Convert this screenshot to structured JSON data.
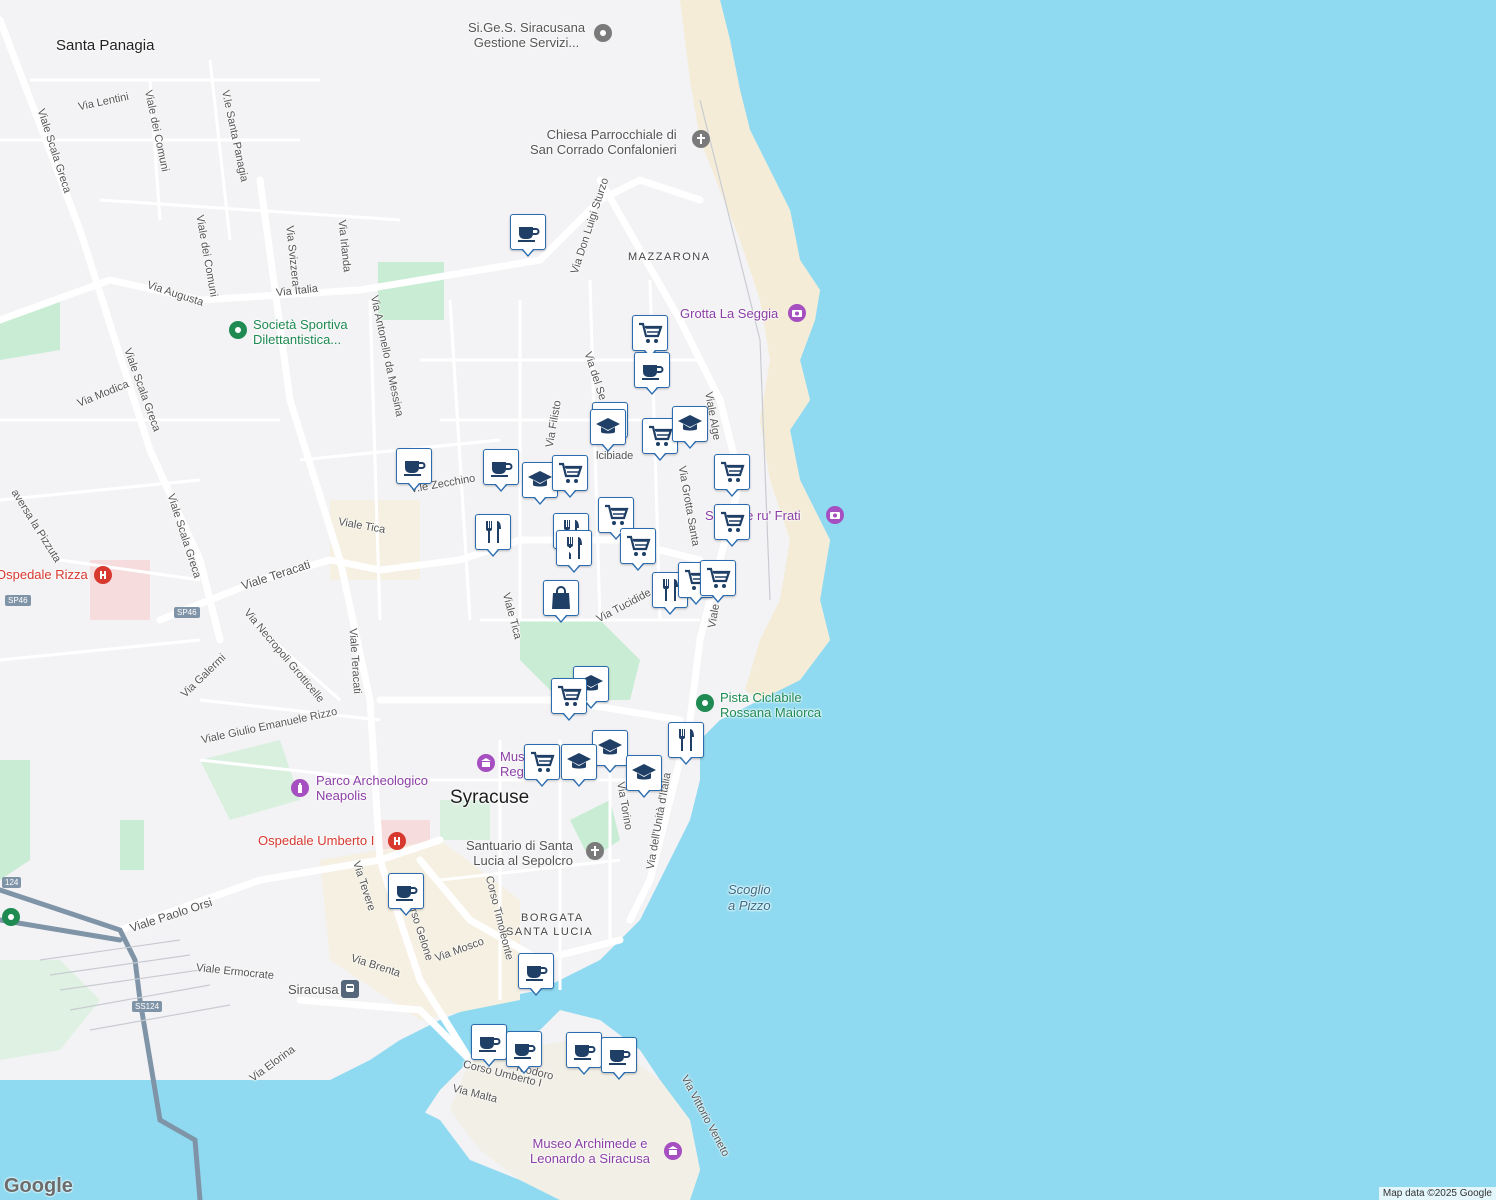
{
  "map": {
    "sea_color": "#8fdaf0",
    "land_color": "#f3f3f5",
    "park_color": "#c9ecd4",
    "beach_color": "#f4ecd7",
    "marker_color": "#2b6cb0"
  },
  "labels": {
    "areas": {
      "santa_panagia": "Santa Panagia",
      "mazzarona": "MAZZARONA",
      "syracuse": "Syracuse",
      "borgata": "BORGATA",
      "santa_lucia": "SANTA LUCIA"
    },
    "streets": {
      "via_lentini": "Via Lentini",
      "viale_scala_greca_1": "Viale Scala Greca",
      "viale_dei_comuni_1": "Viale dei Comuni",
      "viale_santa_panagia": "V.le Santa Panagia",
      "viale_dei_comuni_2": "Viale dei Comuni",
      "via_svizzera": "Via Svizzera",
      "via_irlanda": "Via Irlanda",
      "via_augusta": "Via Augusta",
      "via_italia": "Via Italia",
      "viale_scala_greca_2": "Viale Scala Greca",
      "via_antonello": "Via Antonello da Messina",
      "via_don_luigi_sturzo": "Via Don Luigi Sturzo",
      "via_modica": "Via Modica",
      "via_del_se": "Via del Se",
      "via_filisto": "Via Filisto",
      "alcibiade": "lcibiade",
      "viale_algeri": "Viale Alge",
      "viale_zecchino": "V.le Zecchino",
      "viale_scala_greca_3": "Viale Scala Greca",
      "traversa_pizzuta": "aversa la Pizzuta",
      "viale_tica_1": "Viale Tica",
      "viale_teracati_1": "Viale Teracati",
      "via_grotta_santa": "Via Grotta Santa",
      "via_tucidide": "Via Tucidide",
      "viale_tica_2": "Viale Tica",
      "via_necropoli": "Via Necropoli Grotticelle",
      "via_galermi": "Via Galermi",
      "viale_teracati_2": "Viale Teracati",
      "viale_giulio": "Viale Giulio Emanuele Rizzo",
      "via_torino": "Via Torino",
      "via_unita": "Via dell'Unità d'Italia",
      "viale_paolo_orsi": "Viale Paolo Orsi",
      "via_tevere": "Via Tevere",
      "corso_gelone": "Corso Gelone",
      "corso_timoleonte": "Corso Timoleonte",
      "via_mosco": "Via Mosco",
      "via_brenta": "Via Brenta",
      "viale_ermocrate": "Viale Ermocrate",
      "via_elorina": "Via Elorina",
      "corso_umberto": "Corso Umberto I",
      "via_teodoro": "Teodoro",
      "via_malta": "Via Malta",
      "via_vittorio_veneto": "Via Vittorio Veneto",
      "viale_lower": "Viale"
    },
    "roads": {
      "sp46_a": "SP46",
      "sp46_b": "SP46",
      "ss124": "SS124",
      "ss124_b": "124"
    },
    "pois": {
      "sigess": "Si.Ge.S. Siracusana\nGestione Servizi...",
      "chiesa": "Chiesa Parrocchiale di\nSan Corrado Confalonieri",
      "grotta": "Grotta La Seggia",
      "societa": "Società Sportiva\nDilettantistica...",
      "scoglio_frati": "S      o e ru' Frati",
      "ospedale_rizza": "Ospedale Rizza",
      "pista": "Pista Ciclabile\nRossana Maiorca",
      "museo_regionale": "Muse\nRegi",
      "parco": "Parco Archeologico\nNeapolis",
      "ospedale_umberto": "Ospedale Umberto I",
      "santuario": "Santuario di Santa\nLucia al Sepolcro",
      "scoglio_pizzo": "Scoglio\na Pizzo",
      "siracusa_station": "Siracusa",
      "museo_archimede": "Museo Archimede e\nLeonardo a Siracusa"
    }
  },
  "markers": [
    {
      "type": "cafe"
    },
    {
      "type": "cart"
    },
    {
      "type": "cafe"
    },
    {
      "type": "school"
    },
    {
      "type": "school"
    },
    {
      "type": "cart"
    },
    {
      "type": "school"
    },
    {
      "type": "cart"
    },
    {
      "type": "cafe"
    },
    {
      "type": "cafe"
    },
    {
      "type": "school"
    },
    {
      "type": "restaurant"
    },
    {
      "type": "cart"
    },
    {
      "type": "restaurant"
    },
    {
      "type": "cart"
    },
    {
      "type": "cart"
    },
    {
      "type": "cart"
    },
    {
      "type": "restaurant"
    },
    {
      "type": "cart"
    },
    {
      "type": "cart"
    },
    {
      "type": "restaurant"
    },
    {
      "type": "bag"
    },
    {
      "type": "school"
    },
    {
      "type": "cart"
    },
    {
      "type": "restaurant"
    },
    {
      "type": "school"
    },
    {
      "type": "cart"
    },
    {
      "type": "school"
    },
    {
      "type": "school"
    },
    {
      "type": "cafe"
    },
    {
      "type": "cafe"
    },
    {
      "type": "cafe"
    },
    {
      "type": "cafe"
    },
    {
      "type": "cafe"
    },
    {
      "type": "cafe"
    }
  ],
  "footer": {
    "logo": "Google",
    "attribution": "Map data ©2025 Google"
  }
}
